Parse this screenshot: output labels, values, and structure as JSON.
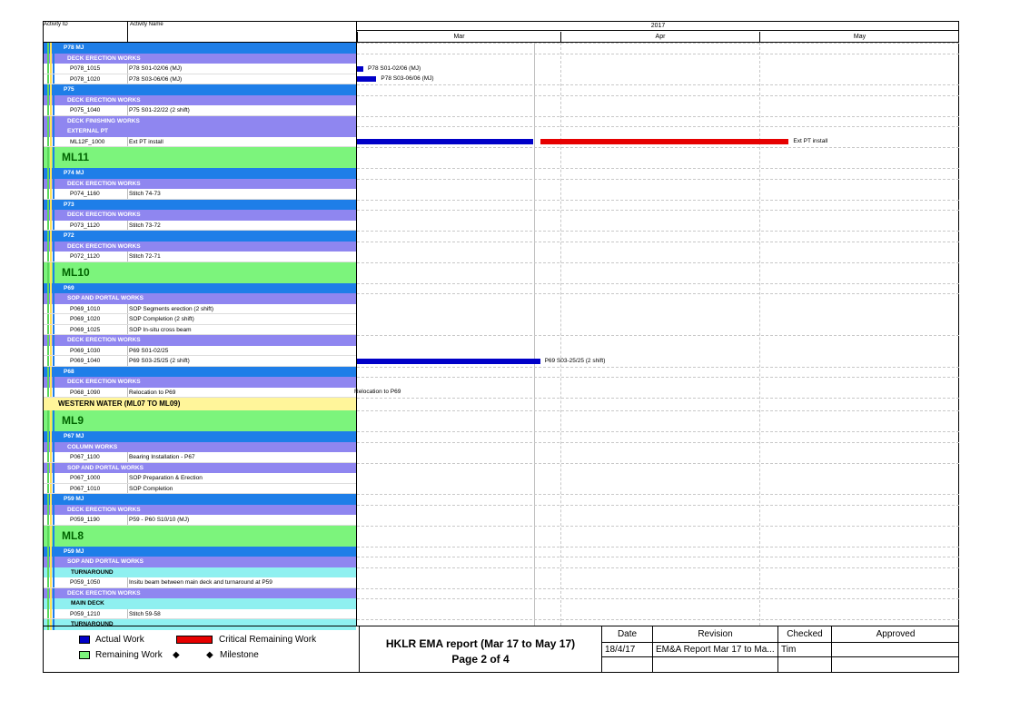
{
  "header": {
    "activity_id": "Activity ID",
    "activity_name": "Activity Name",
    "year": "2017",
    "months": [
      "Mar",
      "Apr",
      "May"
    ]
  },
  "colors": {
    "wbs_blue": "#1e7ee8",
    "wbs_purple": "#8f86f0",
    "ml_green": "#7cf47c",
    "ww_yellow": "#fff59a",
    "cyan": "#8ff0f0",
    "actual": "#0000c8",
    "critical": "#e60000"
  },
  "rows": [
    {
      "type": "wbs1",
      "text": "P78 MJ"
    },
    {
      "type": "wbs2",
      "text": "DECK ERECTION WORKS"
    },
    {
      "type": "act",
      "id": "P078_1015",
      "name": "P78 S01-02/06 (MJ)"
    },
    {
      "type": "act",
      "id": "P078_1020",
      "name": "P78 S03-06/06 (MJ)"
    },
    {
      "type": "wbs1",
      "text": "P75"
    },
    {
      "type": "wbs2",
      "text": "DECK ERECTION WORKS"
    },
    {
      "type": "act",
      "id": "P075_1040",
      "name": "P75 S01-22/22 (2 shift)"
    },
    {
      "type": "wbs2",
      "text": "DECK FINISHING WORKS"
    },
    {
      "type": "wbs2",
      "text": "EXTERNAL PT"
    },
    {
      "type": "act",
      "id": "ML12F_1000",
      "name": "Ext PT install"
    },
    {
      "type": "ml",
      "text": "ML11"
    },
    {
      "type": "wbs1",
      "text": "P74 MJ"
    },
    {
      "type": "wbs2",
      "text": "DECK ERECTION WORKS"
    },
    {
      "type": "act",
      "id": "P074_1160",
      "name": "Stitch 74-73"
    },
    {
      "type": "wbs1",
      "text": "P73"
    },
    {
      "type": "wbs2",
      "text": "DECK ERECTION WORKS"
    },
    {
      "type": "act",
      "id": "P073_1120",
      "name": "Stitch 73-72"
    },
    {
      "type": "wbs1",
      "text": "P72"
    },
    {
      "type": "wbs2",
      "text": "DECK ERECTION WORKS"
    },
    {
      "type": "act",
      "id": "P072_1120",
      "name": "Stitch 72-71"
    },
    {
      "type": "ml",
      "text": "ML10"
    },
    {
      "type": "wbs1",
      "text": "P69"
    },
    {
      "type": "wbs2",
      "text": "SOP AND PORTAL WORKS"
    },
    {
      "type": "act",
      "id": "P069_1010",
      "name": "SOP Segments erection (2 shift)"
    },
    {
      "type": "act",
      "id": "P069_1020",
      "name": "SOP Completion (2 shift)"
    },
    {
      "type": "act",
      "id": "P069_1025",
      "name": "SOP In-situ cross beam"
    },
    {
      "type": "wbs2",
      "text": "DECK ERECTION WORKS"
    },
    {
      "type": "act",
      "id": "P069_1030",
      "name": "P69 S01-02/25"
    },
    {
      "type": "act",
      "id": "P069_1040",
      "name": "P69 S03-25/25 (2 shift)"
    },
    {
      "type": "wbs1",
      "text": "P68"
    },
    {
      "type": "wbs2",
      "text": "DECK ERECTION WORKS"
    },
    {
      "type": "act",
      "id": "P068_1090",
      "name": "Relocation to P69"
    },
    {
      "type": "ww",
      "text": "WESTERN WATER (ML07 TO ML09)"
    },
    {
      "type": "ml",
      "text": "ML9"
    },
    {
      "type": "wbs1",
      "text": "P67 MJ"
    },
    {
      "type": "wbs2",
      "text": "COLUMN WORKS"
    },
    {
      "type": "act",
      "id": "P067_1100",
      "name": "Bearing Installation - P67"
    },
    {
      "type": "wbs2",
      "text": "SOP AND PORTAL WORKS"
    },
    {
      "type": "act",
      "id": "P067_1000",
      "name": "SOP Preparation & Erection"
    },
    {
      "type": "act",
      "id": "P067_1010",
      "name": "SOP Completion"
    },
    {
      "type": "wbs1",
      "text": "P59 MJ"
    },
    {
      "type": "wbs2",
      "text": "DECK ERECTION WORKS"
    },
    {
      "type": "act",
      "id": "P059_1190",
      "name": "P59 - P60 S10/10 (MJ)"
    },
    {
      "type": "ml",
      "text": "ML8"
    },
    {
      "type": "wbs1",
      "text": "P59 MJ"
    },
    {
      "type": "wbs2",
      "text": "SOP AND PORTAL WORKS"
    },
    {
      "type": "wbs3",
      "text": "TURNAROUND"
    },
    {
      "type": "act",
      "id": "P059_1050",
      "name": "Insitu beam between main deck and turnaround at P59"
    },
    {
      "type": "wbs2",
      "text": "DECK ERECTION WORKS"
    },
    {
      "type": "wbs3",
      "text": "MAIN DECK"
    },
    {
      "type": "act",
      "id": "P059_1210",
      "name": "Stitch 59-58"
    },
    {
      "type": "wbs3",
      "text": "TURNAROUND"
    }
  ],
  "bars": [
    {
      "row": 2,
      "kind": "actual",
      "start": "2017-03-01",
      "end": "2017-03-01",
      "label": "P78 S01-02/06 (MJ)"
    },
    {
      "row": 3,
      "kind": "actual",
      "start": "2017-03-01",
      "end": "2017-03-03",
      "label": "P78 S03-06/06 (MJ)"
    },
    {
      "row": 9,
      "kind": "actual",
      "start": "2017-03-01",
      "end": "2017-03-27",
      "label": ""
    },
    {
      "row": 9,
      "kind": "critical",
      "start": "2017-03-29",
      "end": "2017-05-05",
      "label": "Ext PT install"
    },
    {
      "row": 28,
      "kind": "actual",
      "start": "2017-03-01",
      "end": "2017-03-28",
      "label": "P69 S03-25/25 (2 shift)"
    },
    {
      "row": 31,
      "kind": "none",
      "start": "2017-03-01",
      "end": "2017-03-01",
      "label": "Relocation to P69"
    }
  ],
  "legend": {
    "actual": "Actual Work",
    "critical": "Critical Remaining Work",
    "remaining": "Remaining Work",
    "milestone": "Milestone",
    "diamond": "◆"
  },
  "title": {
    "line1": "HKLR EMA report (Mar 17 to May 17)",
    "line2": "Page 2 of 4"
  },
  "signoff": {
    "headers": [
      "Date",
      "Revision",
      "Checked",
      "Approved"
    ],
    "row": [
      "18/4/17",
      "EM&A Report Mar 17 to Ma...",
      "Tim",
      ""
    ]
  }
}
